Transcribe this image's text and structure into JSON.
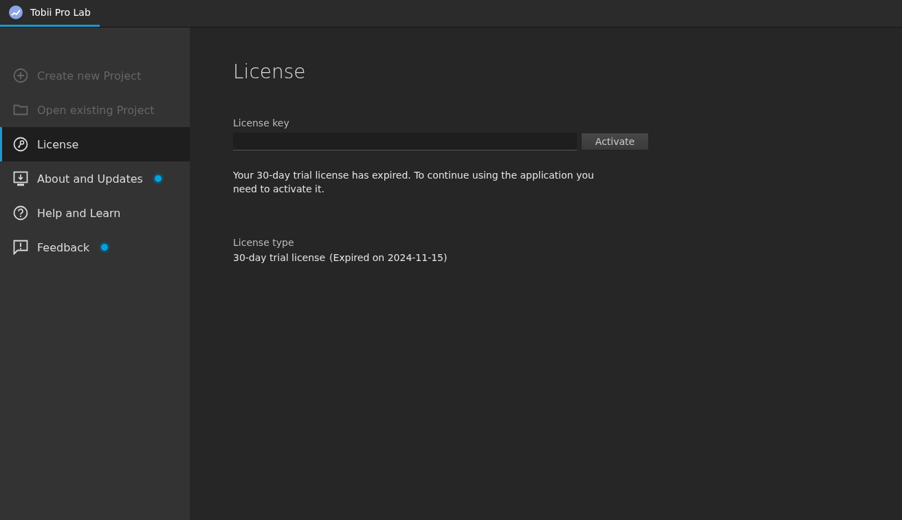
{
  "window": {
    "title": "Tobii Pro Lab"
  },
  "sidebar": {
    "items": [
      {
        "label": "Create new Project",
        "disabled": true,
        "selected": false,
        "notification": false
      },
      {
        "label": "Open existing Project",
        "disabled": true,
        "selected": false,
        "notification": false
      },
      {
        "label": "License",
        "disabled": false,
        "selected": true,
        "notification": false
      },
      {
        "label": "About and Updates",
        "disabled": false,
        "selected": false,
        "notification": true
      },
      {
        "label": "Help and Learn",
        "disabled": false,
        "selected": false,
        "notification": false
      },
      {
        "label": "Feedback",
        "disabled": false,
        "selected": false,
        "notification": true
      }
    ]
  },
  "main": {
    "heading": "License",
    "license_key": {
      "label": "License key"
    },
    "activate_button": "Activate",
    "message": "Your 30-day trial license has expired. To continue using the application you need to activate it.",
    "license_type": {
      "label": "License type",
      "value": "30-day trial license",
      "expiry": "(Expired on 2024-11-15)"
    }
  }
}
